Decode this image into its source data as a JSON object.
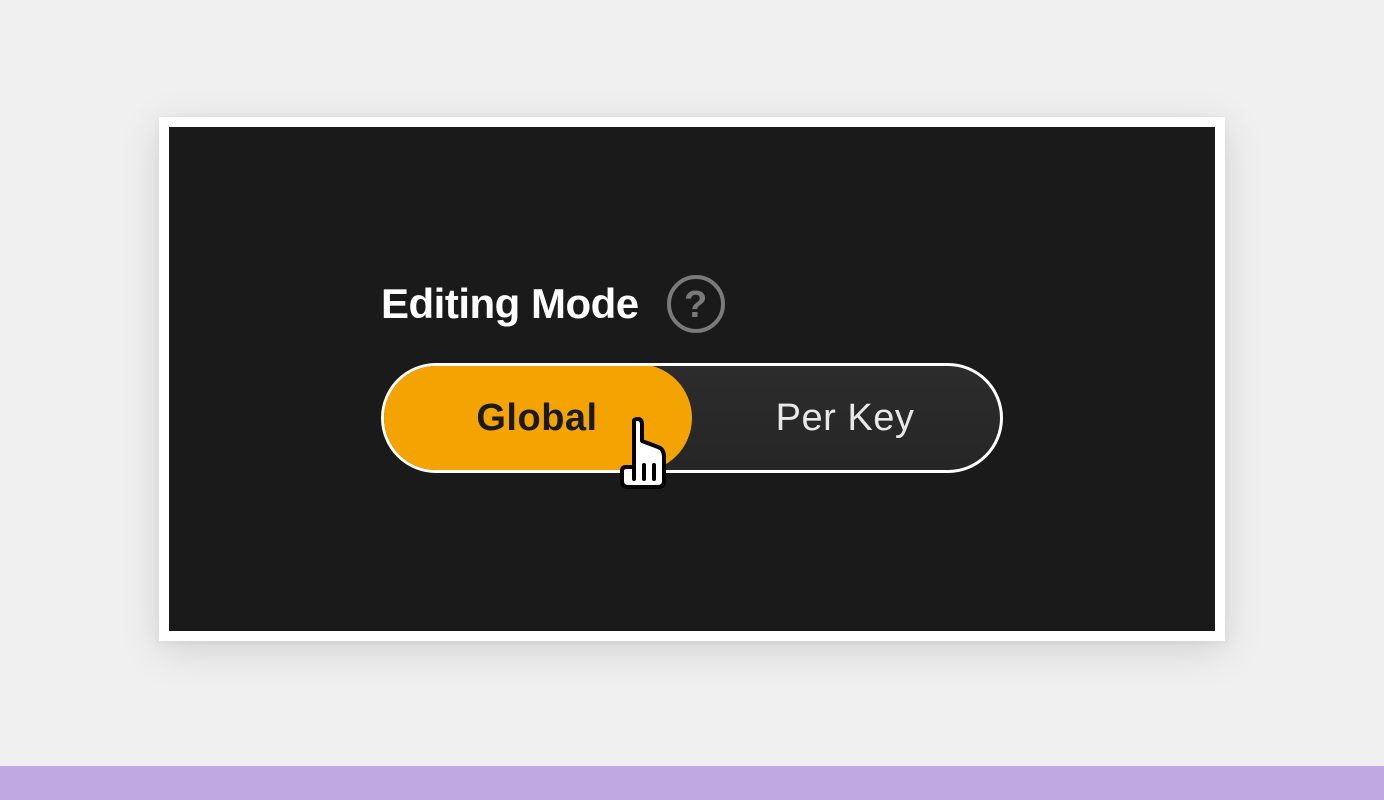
{
  "editing_mode": {
    "title": "Editing Mode",
    "help_glyph": "?",
    "options": {
      "global": "Global",
      "per_key": "Per Key"
    },
    "selected": "global"
  },
  "colors": {
    "accent": "#f5a300",
    "purple_bar": "#c0a9e3",
    "panel_bg": "#1a1a1a"
  }
}
